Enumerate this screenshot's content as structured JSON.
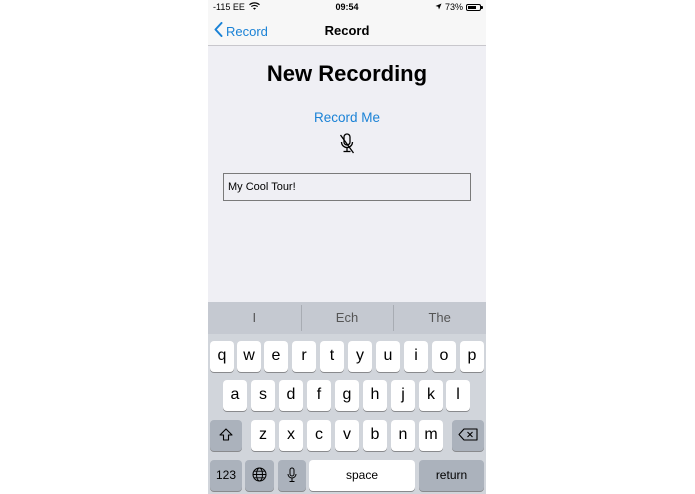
{
  "status_bar": {
    "carrier": "-115 EE",
    "time": "09:54",
    "battery": "73%",
    "battery_level": 0.73
  },
  "nav": {
    "back_label": "Record",
    "title": "Record"
  },
  "content": {
    "heading": "New Recording",
    "record_button": "Record Me",
    "mic_icon": "microphone-slash-icon",
    "tour_name_value": "My Cool Tour!"
  },
  "keyboard": {
    "predictions": [
      "I",
      "Ech",
      "The"
    ],
    "row1": [
      "q",
      "w",
      "e",
      "r",
      "t",
      "y",
      "u",
      "i",
      "o",
      "p"
    ],
    "row2": [
      "a",
      "s",
      "d",
      "f",
      "g",
      "h",
      "j",
      "k",
      "l"
    ],
    "row3": [
      "z",
      "x",
      "c",
      "v",
      "b",
      "n",
      "m"
    ],
    "numbers_label": "123",
    "space_label": "space",
    "return_label": "return",
    "shift_icon": "shift-icon",
    "delete_icon": "delete-icon",
    "globe_icon": "globe-icon",
    "dictation_icon": "microphone-icon"
  }
}
